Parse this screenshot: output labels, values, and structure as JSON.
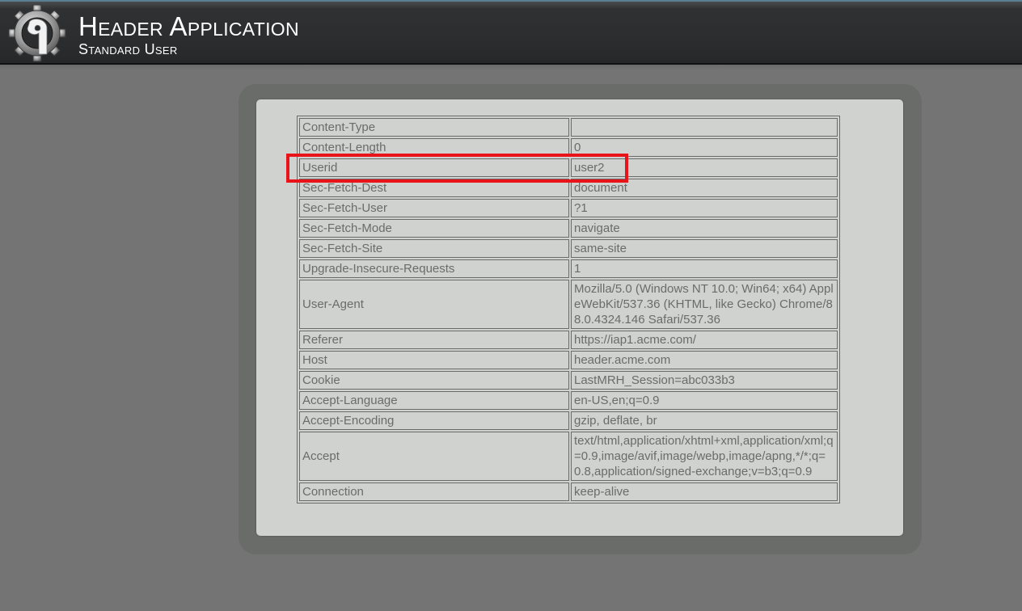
{
  "header": {
    "title": "Header Application",
    "subtitle": "Standard User",
    "logo_icon": "gear-logo-icon"
  },
  "table": {
    "rows": [
      {
        "name": "Content-Type",
        "value": ""
      },
      {
        "name": "Content-Length",
        "value": "0"
      },
      {
        "name": "Userid",
        "value": "user2"
      },
      {
        "name": "Sec-Fetch-Dest",
        "value": "document"
      },
      {
        "name": "Sec-Fetch-User",
        "value": "?1"
      },
      {
        "name": "Sec-Fetch-Mode",
        "value": "navigate"
      },
      {
        "name": "Sec-Fetch-Site",
        "value": "same-site"
      },
      {
        "name": "Upgrade-Insecure-Requests",
        "value": "1"
      },
      {
        "name": "User-Agent",
        "value": "Mozilla/5.0 (Windows NT 10.0; Win64; x64) AppleWebKit/537.36 (KHTML, like Gecko) Chrome/88.0.4324.146 Safari/537.36"
      },
      {
        "name": "Referer",
        "value": "https://iap1.acme.com/"
      },
      {
        "name": "Host",
        "value": "header.acme.com"
      },
      {
        "name": "Cookie",
        "value": "LastMRH_Session=abc033b3"
      },
      {
        "name": "Accept-Language",
        "value": "en-US,en;q=0.9"
      },
      {
        "name": "Accept-Encoding",
        "value": "gzip, deflate, br"
      },
      {
        "name": "Accept",
        "value": "text/html,application/xhtml+xml,application/xml;q=0.9,image/avif,image/webp,image/apng,*/*;q=0.8,application/signed-exchange;v=b3;q=0.9"
      },
      {
        "name": "Connection",
        "value": "keep-alive"
      }
    ]
  },
  "colors": {
    "highlight": "#e8141a",
    "header_bg": "#2b2d2f",
    "page_bg": "#747474",
    "panel_bg": "#cfd2cf"
  }
}
